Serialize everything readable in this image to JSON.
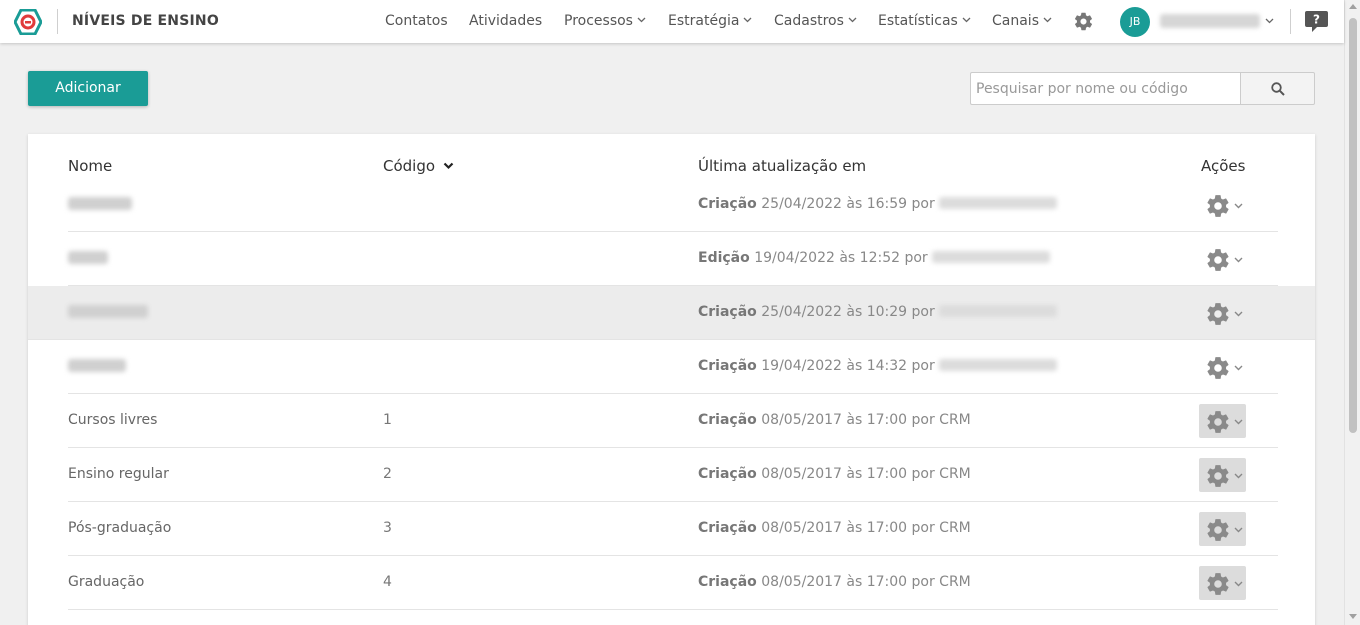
{
  "header": {
    "title": "NÍVEIS DE ENSINO",
    "nav": [
      "Contatos",
      "Atividades",
      "Processos",
      "Estratégia",
      "Cadastros",
      "Estatísticas",
      "Canais"
    ],
    "user_initials": "JB"
  },
  "toolbar": {
    "add_label": "Adicionar",
    "search_placeholder": "Pesquisar por nome ou código"
  },
  "table": {
    "columns": {
      "nome": "Nome",
      "codigo": "Código",
      "atualizacao": "Última atualização em",
      "acoes": "Ações"
    },
    "rows": [
      {
        "nome": "",
        "codigo": "",
        "tipo": "Criação",
        "data": "25/04/2022 às 16:59 por",
        "usuario": ""
      },
      {
        "nome": "",
        "codigo": "",
        "tipo": "Edição",
        "data": "19/04/2022 às 12:52 por",
        "usuario": ""
      },
      {
        "nome": "",
        "codigo": "",
        "tipo": "Criação",
        "data": "25/04/2022 às 10:29 por",
        "usuario": ""
      },
      {
        "nome": "",
        "codigo": "",
        "tipo": "Criação",
        "data": "19/04/2022 às 14:32 por",
        "usuario": ""
      },
      {
        "nome": "Cursos livres",
        "codigo": "1",
        "tipo": "Criação",
        "data": "08/05/2017 às 17:00 por",
        "usuario": "CRM"
      },
      {
        "nome": "Ensino regular",
        "codigo": "2",
        "tipo": "Criação",
        "data": "08/05/2017 às 17:00 por",
        "usuario": "CRM"
      },
      {
        "nome": "Pós-graduação",
        "codigo": "3",
        "tipo": "Criação",
        "data": "08/05/2017 às 17:00 por",
        "usuario": "CRM"
      },
      {
        "nome": "Graduação",
        "codigo": "4",
        "tipo": "Criação",
        "data": "08/05/2017 às 17:00 por",
        "usuario": "CRM"
      }
    ]
  },
  "colors": {
    "accent": "#1a9c96",
    "highlight_row": "#ececec"
  },
  "icons": [
    "logo-icon",
    "gear-icon",
    "chevron-down-icon",
    "help-icon",
    "search-icon",
    "sort-down-icon"
  ]
}
